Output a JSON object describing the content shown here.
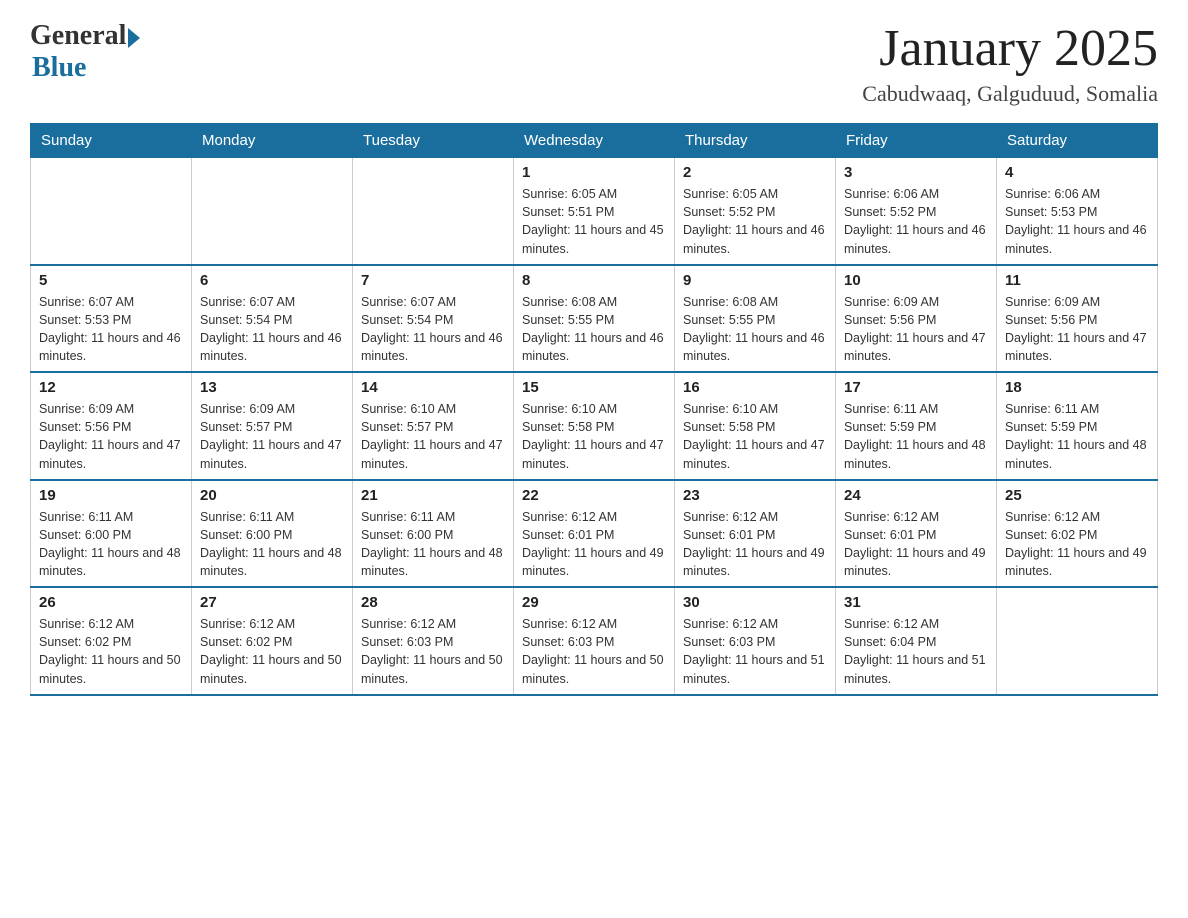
{
  "logo": {
    "general": "General",
    "blue": "Blue"
  },
  "header": {
    "month": "January 2025",
    "location": "Cabudwaaq, Galguduud, Somalia"
  },
  "days_of_week": [
    "Sunday",
    "Monday",
    "Tuesday",
    "Wednesday",
    "Thursday",
    "Friday",
    "Saturday"
  ],
  "weeks": [
    [
      {
        "day": "",
        "info": ""
      },
      {
        "day": "",
        "info": ""
      },
      {
        "day": "",
        "info": ""
      },
      {
        "day": "1",
        "info": "Sunrise: 6:05 AM\nSunset: 5:51 PM\nDaylight: 11 hours and 45 minutes."
      },
      {
        "day": "2",
        "info": "Sunrise: 6:05 AM\nSunset: 5:52 PM\nDaylight: 11 hours and 46 minutes."
      },
      {
        "day": "3",
        "info": "Sunrise: 6:06 AM\nSunset: 5:52 PM\nDaylight: 11 hours and 46 minutes."
      },
      {
        "day": "4",
        "info": "Sunrise: 6:06 AM\nSunset: 5:53 PM\nDaylight: 11 hours and 46 minutes."
      }
    ],
    [
      {
        "day": "5",
        "info": "Sunrise: 6:07 AM\nSunset: 5:53 PM\nDaylight: 11 hours and 46 minutes."
      },
      {
        "day": "6",
        "info": "Sunrise: 6:07 AM\nSunset: 5:54 PM\nDaylight: 11 hours and 46 minutes."
      },
      {
        "day": "7",
        "info": "Sunrise: 6:07 AM\nSunset: 5:54 PM\nDaylight: 11 hours and 46 minutes."
      },
      {
        "day": "8",
        "info": "Sunrise: 6:08 AM\nSunset: 5:55 PM\nDaylight: 11 hours and 46 minutes."
      },
      {
        "day": "9",
        "info": "Sunrise: 6:08 AM\nSunset: 5:55 PM\nDaylight: 11 hours and 46 minutes."
      },
      {
        "day": "10",
        "info": "Sunrise: 6:09 AM\nSunset: 5:56 PM\nDaylight: 11 hours and 47 minutes."
      },
      {
        "day": "11",
        "info": "Sunrise: 6:09 AM\nSunset: 5:56 PM\nDaylight: 11 hours and 47 minutes."
      }
    ],
    [
      {
        "day": "12",
        "info": "Sunrise: 6:09 AM\nSunset: 5:56 PM\nDaylight: 11 hours and 47 minutes."
      },
      {
        "day": "13",
        "info": "Sunrise: 6:09 AM\nSunset: 5:57 PM\nDaylight: 11 hours and 47 minutes."
      },
      {
        "day": "14",
        "info": "Sunrise: 6:10 AM\nSunset: 5:57 PM\nDaylight: 11 hours and 47 minutes."
      },
      {
        "day": "15",
        "info": "Sunrise: 6:10 AM\nSunset: 5:58 PM\nDaylight: 11 hours and 47 minutes."
      },
      {
        "day": "16",
        "info": "Sunrise: 6:10 AM\nSunset: 5:58 PM\nDaylight: 11 hours and 47 minutes."
      },
      {
        "day": "17",
        "info": "Sunrise: 6:11 AM\nSunset: 5:59 PM\nDaylight: 11 hours and 48 minutes."
      },
      {
        "day": "18",
        "info": "Sunrise: 6:11 AM\nSunset: 5:59 PM\nDaylight: 11 hours and 48 minutes."
      }
    ],
    [
      {
        "day": "19",
        "info": "Sunrise: 6:11 AM\nSunset: 6:00 PM\nDaylight: 11 hours and 48 minutes."
      },
      {
        "day": "20",
        "info": "Sunrise: 6:11 AM\nSunset: 6:00 PM\nDaylight: 11 hours and 48 minutes."
      },
      {
        "day": "21",
        "info": "Sunrise: 6:11 AM\nSunset: 6:00 PM\nDaylight: 11 hours and 48 minutes."
      },
      {
        "day": "22",
        "info": "Sunrise: 6:12 AM\nSunset: 6:01 PM\nDaylight: 11 hours and 49 minutes."
      },
      {
        "day": "23",
        "info": "Sunrise: 6:12 AM\nSunset: 6:01 PM\nDaylight: 11 hours and 49 minutes."
      },
      {
        "day": "24",
        "info": "Sunrise: 6:12 AM\nSunset: 6:01 PM\nDaylight: 11 hours and 49 minutes."
      },
      {
        "day": "25",
        "info": "Sunrise: 6:12 AM\nSunset: 6:02 PM\nDaylight: 11 hours and 49 minutes."
      }
    ],
    [
      {
        "day": "26",
        "info": "Sunrise: 6:12 AM\nSunset: 6:02 PM\nDaylight: 11 hours and 50 minutes."
      },
      {
        "day": "27",
        "info": "Sunrise: 6:12 AM\nSunset: 6:02 PM\nDaylight: 11 hours and 50 minutes."
      },
      {
        "day": "28",
        "info": "Sunrise: 6:12 AM\nSunset: 6:03 PM\nDaylight: 11 hours and 50 minutes."
      },
      {
        "day": "29",
        "info": "Sunrise: 6:12 AM\nSunset: 6:03 PM\nDaylight: 11 hours and 50 minutes."
      },
      {
        "day": "30",
        "info": "Sunrise: 6:12 AM\nSunset: 6:03 PM\nDaylight: 11 hours and 51 minutes."
      },
      {
        "day": "31",
        "info": "Sunrise: 6:12 AM\nSunset: 6:04 PM\nDaylight: 11 hours and 51 minutes."
      },
      {
        "day": "",
        "info": ""
      }
    ]
  ]
}
